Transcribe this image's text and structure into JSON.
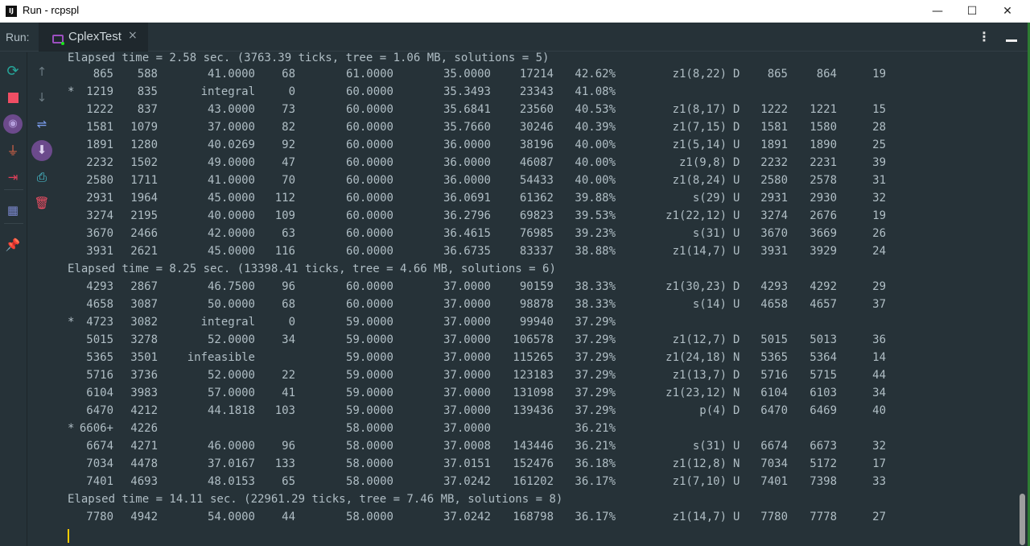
{
  "window": {
    "title": "Run - rcpspl",
    "app_icon": "IJ",
    "minimize": "—",
    "maximize": "☐",
    "close": "✕"
  },
  "run_panel": {
    "label": "Run:",
    "tab_label": "CplexTest",
    "tab_close": "×",
    "more_icon": "⋮"
  },
  "toolbar_left": [
    "rerun-icon",
    "stop-icon",
    "screenshot-icon",
    "plug-icon",
    "exit-icon",
    "layout-icon",
    "pin-icon"
  ],
  "toolbar_right": [
    "up-arrow-icon",
    "down-arrow-icon",
    "soft-wrap-icon",
    "scroll-to-end-icon",
    "print-icon",
    "trash-icon"
  ],
  "colors": {
    "background": "#263238",
    "text": "#b0bec5",
    "cursor": "#ffcc00",
    "accent": "#9c4fc0"
  },
  "console": {
    "partial_line": "Elapsed time = 2.58 sec. (3763.39 ticks, tree = 1.06 MB, solutions = 5)",
    "lines": [
      {
        "star": "",
        "node": "865",
        "left": "588",
        "obj": "41.0000",
        "iinf": "68",
        "best": "61.0000",
        "bound": "35.0000",
        "itcnt": "17214",
        "gap": "42.62%",
        "var": "z1(8,22)",
        "dir": "D",
        "mipcnt": "865",
        "parent": "864",
        "depth": "19"
      },
      {
        "star": "*",
        "node": "1219",
        "left": "835",
        "obj": "integral",
        "iinf": "0",
        "best": "60.0000",
        "bound": "35.3493",
        "itcnt": "23343",
        "gap": "41.08%",
        "var": "",
        "dir": "",
        "mipcnt": "",
        "parent": "",
        "depth": ""
      },
      {
        "star": "",
        "node": "1222",
        "left": "837",
        "obj": "43.0000",
        "iinf": "73",
        "best": "60.0000",
        "bound": "35.6841",
        "itcnt": "23560",
        "gap": "40.53%",
        "var": "z1(8,17)",
        "dir": "D",
        "mipcnt": "1222",
        "parent": "1221",
        "depth": "15"
      },
      {
        "star": "",
        "node": "1581",
        "left": "1079",
        "obj": "37.0000",
        "iinf": "82",
        "best": "60.0000",
        "bound": "35.7660",
        "itcnt": "30246",
        "gap": "40.39%",
        "var": "z1(7,15)",
        "dir": "D",
        "mipcnt": "1581",
        "parent": "1580",
        "depth": "28"
      },
      {
        "star": "",
        "node": "1891",
        "left": "1280",
        "obj": "40.0269",
        "iinf": "92",
        "best": "60.0000",
        "bound": "36.0000",
        "itcnt": "38196",
        "gap": "40.00%",
        "var": "z1(5,14)",
        "dir": "U",
        "mipcnt": "1891",
        "parent": "1890",
        "depth": "25"
      },
      {
        "star": "",
        "node": "2232",
        "left": "1502",
        "obj": "49.0000",
        "iinf": "47",
        "best": "60.0000",
        "bound": "36.0000",
        "itcnt": "46087",
        "gap": "40.00%",
        "var": "z1(9,8)",
        "dir": "D",
        "mipcnt": "2232",
        "parent": "2231",
        "depth": "39"
      },
      {
        "star": "",
        "node": "2580",
        "left": "1711",
        "obj": "41.0000",
        "iinf": "70",
        "best": "60.0000",
        "bound": "36.0000",
        "itcnt": "54433",
        "gap": "40.00%",
        "var": "z1(8,24)",
        "dir": "U",
        "mipcnt": "2580",
        "parent": "2578",
        "depth": "31"
      },
      {
        "star": "",
        "node": "2931",
        "left": "1964",
        "obj": "45.0000",
        "iinf": "112",
        "best": "60.0000",
        "bound": "36.0691",
        "itcnt": "61362",
        "gap": "39.88%",
        "var": "s(29)",
        "dir": "U",
        "mipcnt": "2931",
        "parent": "2930",
        "depth": "32"
      },
      {
        "star": "",
        "node": "3274",
        "left": "2195",
        "obj": "40.0000",
        "iinf": "109",
        "best": "60.0000",
        "bound": "36.2796",
        "itcnt": "69823",
        "gap": "39.53%",
        "var": "z1(22,12)",
        "dir": "U",
        "mipcnt": "3274",
        "parent": "2676",
        "depth": "19"
      },
      {
        "star": "",
        "node": "3670",
        "left": "2466",
        "obj": "42.0000",
        "iinf": "63",
        "best": "60.0000",
        "bound": "36.4615",
        "itcnt": "76985",
        "gap": "39.23%",
        "var": "s(31)",
        "dir": "U",
        "mipcnt": "3670",
        "parent": "3669",
        "depth": "26"
      },
      {
        "star": "",
        "node": "3931",
        "left": "2621",
        "obj": "45.0000",
        "iinf": "116",
        "best": "60.0000",
        "bound": "36.6735",
        "itcnt": "83337",
        "gap": "38.88%",
        "var": "z1(14,7)",
        "dir": "U",
        "mipcnt": "3931",
        "parent": "3929",
        "depth": "24"
      },
      {
        "text": "Elapsed time = 8.25 sec. (13398.41 ticks, tree = 4.66 MB, solutions = 6)"
      },
      {
        "star": "",
        "node": "4293",
        "left": "2867",
        "obj": "46.7500",
        "iinf": "96",
        "best": "60.0000",
        "bound": "37.0000",
        "itcnt": "90159",
        "gap": "38.33%",
        "var": "z1(30,23)",
        "dir": "D",
        "mipcnt": "4293",
        "parent": "4292",
        "depth": "29"
      },
      {
        "star": "",
        "node": "4658",
        "left": "3087",
        "obj": "50.0000",
        "iinf": "68",
        "best": "60.0000",
        "bound": "37.0000",
        "itcnt": "98878",
        "gap": "38.33%",
        "var": "s(14)",
        "dir": "U",
        "mipcnt": "4658",
        "parent": "4657",
        "depth": "37"
      },
      {
        "star": "*",
        "node": "4723",
        "left": "3082",
        "obj": "integral",
        "iinf": "0",
        "best": "59.0000",
        "bound": "37.0000",
        "itcnt": "99940",
        "gap": "37.29%",
        "var": "",
        "dir": "",
        "mipcnt": "",
        "parent": "",
        "depth": ""
      },
      {
        "star": "",
        "node": "5015",
        "left": "3278",
        "obj": "52.0000",
        "iinf": "34",
        "best": "59.0000",
        "bound": "37.0000",
        "itcnt": "106578",
        "gap": "37.29%",
        "var": "z1(12,7)",
        "dir": "D",
        "mipcnt": "5015",
        "parent": "5013",
        "depth": "36"
      },
      {
        "star": "",
        "node": "5365",
        "left": "3501",
        "obj": "infeasible",
        "iinf": "",
        "best": "59.0000",
        "bound": "37.0000",
        "itcnt": "115265",
        "gap": "37.29%",
        "var": "z1(24,18)",
        "dir": "N",
        "mipcnt": "5365",
        "parent": "5364",
        "depth": "14"
      },
      {
        "star": "",
        "node": "5716",
        "left": "3736",
        "obj": "52.0000",
        "iinf": "22",
        "best": "59.0000",
        "bound": "37.0000",
        "itcnt": "123183",
        "gap": "37.29%",
        "var": "z1(13,7)",
        "dir": "D",
        "mipcnt": "5716",
        "parent": "5715",
        "depth": "44"
      },
      {
        "star": "",
        "node": "6104",
        "left": "3983",
        "obj": "57.0000",
        "iinf": "41",
        "best": "59.0000",
        "bound": "37.0000",
        "itcnt": "131098",
        "gap": "37.29%",
        "var": "z1(23,12)",
        "dir": "N",
        "mipcnt": "6104",
        "parent": "6103",
        "depth": "34"
      },
      {
        "star": "",
        "node": "6470",
        "left": "4212",
        "obj": "44.1818",
        "iinf": "103",
        "best": "59.0000",
        "bound": "37.0000",
        "itcnt": "139436",
        "gap": "37.29%",
        "var": "p(4)",
        "dir": "D",
        "mipcnt": "6470",
        "parent": "6469",
        "depth": "40"
      },
      {
        "star": "*",
        "node": "6606+",
        "left": "4226",
        "obj": "",
        "iinf": "",
        "best": "58.0000",
        "bound": "37.0000",
        "itcnt": "",
        "gap": "36.21%",
        "var": "",
        "dir": "",
        "mipcnt": "",
        "parent": "",
        "depth": ""
      },
      {
        "star": "",
        "node": "6674",
        "left": "4271",
        "obj": "46.0000",
        "iinf": "96",
        "best": "58.0000",
        "bound": "37.0008",
        "itcnt": "143446",
        "gap": "36.21%",
        "var": "s(31)",
        "dir": "U",
        "mipcnt": "6674",
        "parent": "6673",
        "depth": "32"
      },
      {
        "star": "",
        "node": "7034",
        "left": "4478",
        "obj": "37.0167",
        "iinf": "133",
        "best": "58.0000",
        "bound": "37.0151",
        "itcnt": "152476",
        "gap": "36.18%",
        "var": "z1(12,8)",
        "dir": "N",
        "mipcnt": "7034",
        "parent": "5172",
        "depth": "17"
      },
      {
        "star": "",
        "node": "7401",
        "left": "4693",
        "obj": "48.0153",
        "iinf": "65",
        "best": "58.0000",
        "bound": "37.0242",
        "itcnt": "161202",
        "gap": "36.17%",
        "var": "z1(7,10)",
        "dir": "U",
        "mipcnt": "7401",
        "parent": "7398",
        "depth": "33"
      },
      {
        "text": "Elapsed time = 14.11 sec. (22961.29 ticks, tree = 7.46 MB, solutions = 8)"
      },
      {
        "star": "",
        "node": "7780",
        "left": "4942",
        "obj": "54.0000",
        "iinf": "44",
        "best": "58.0000",
        "bound": "37.0242",
        "itcnt": "168798",
        "gap": "36.17%",
        "var": "z1(14,7)",
        "dir": "U",
        "mipcnt": "7780",
        "parent": "7778",
        "depth": "27"
      }
    ]
  }
}
